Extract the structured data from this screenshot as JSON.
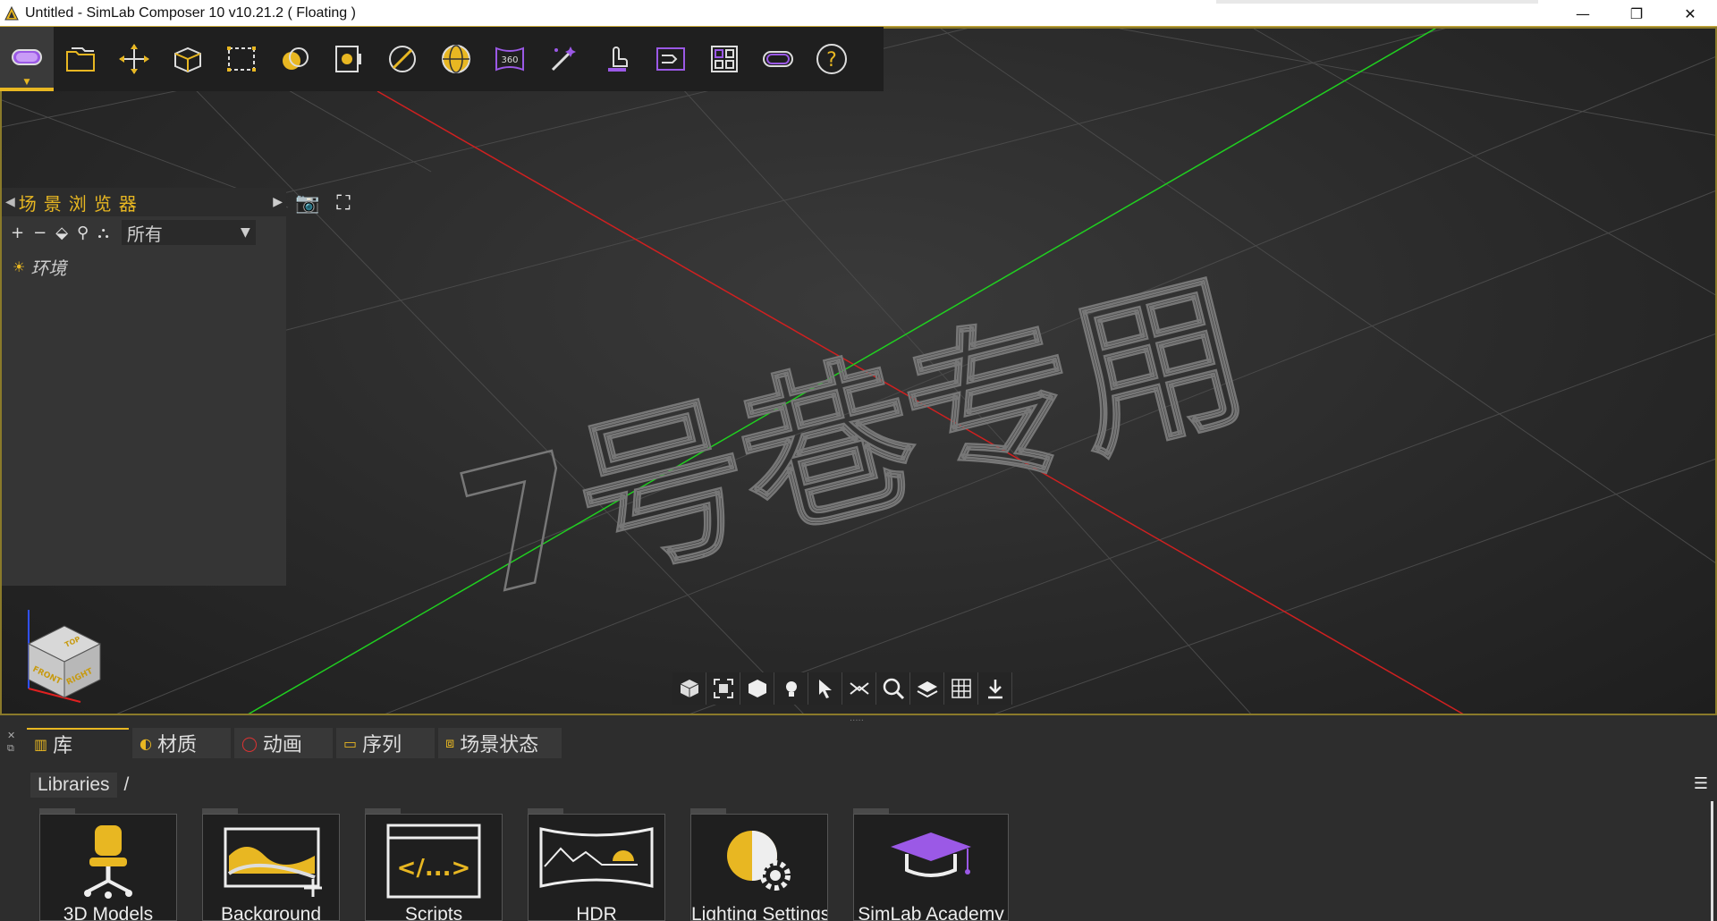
{
  "window": {
    "title": "Untitled - SimLab Composer 10 v10.21.2 ( Floating )",
    "minimize": "—",
    "restore": "❐",
    "close": "✕"
  },
  "toolbar": {
    "items": [
      {
        "name": "vr-headset-icon",
        "active": true
      },
      {
        "name": "open-folder-icon"
      },
      {
        "name": "move-icon"
      },
      {
        "name": "edit-box-icon"
      },
      {
        "name": "selection-rect-icon"
      },
      {
        "name": "materials-icon"
      },
      {
        "name": "render-icon"
      },
      {
        "name": "no-icon"
      },
      {
        "name": "globe-icon"
      },
      {
        "name": "360-icon",
        "text": "360"
      },
      {
        "name": "magic-wand-icon"
      },
      {
        "name": "touch-icon"
      },
      {
        "name": "sequence-icon"
      },
      {
        "name": "layout-icon"
      },
      {
        "name": "vr-goggles-icon"
      },
      {
        "name": "help-icon",
        "text": "?"
      }
    ]
  },
  "scene_browser": {
    "title": "场景浏览器",
    "filter": "所有",
    "items": [
      {
        "label": "环境"
      }
    ]
  },
  "viewcube": {
    "top": "TOP",
    "front": "FRONT",
    "right": "RIGHT"
  },
  "watermark": "7号巷专用",
  "bottom_tabs": [
    {
      "label": "库",
      "active": true
    },
    {
      "label": "材质"
    },
    {
      "label": "动画"
    },
    {
      "label": "序列"
    },
    {
      "label": "场景状态"
    }
  ],
  "breadcrumb": {
    "root": "Libraries",
    "separator": "/"
  },
  "libraries": [
    {
      "label": "3D Models"
    },
    {
      "label": "Background"
    },
    {
      "label": "Scripts"
    },
    {
      "label": "HDR"
    },
    {
      "label": "Lighting Settings"
    },
    {
      "label": "SimLab Academy"
    }
  ],
  "colors": {
    "accent": "#e8b722",
    "x_axis": "#d02020",
    "y_axis": "#20d020",
    "purple": "#9b59e6"
  }
}
